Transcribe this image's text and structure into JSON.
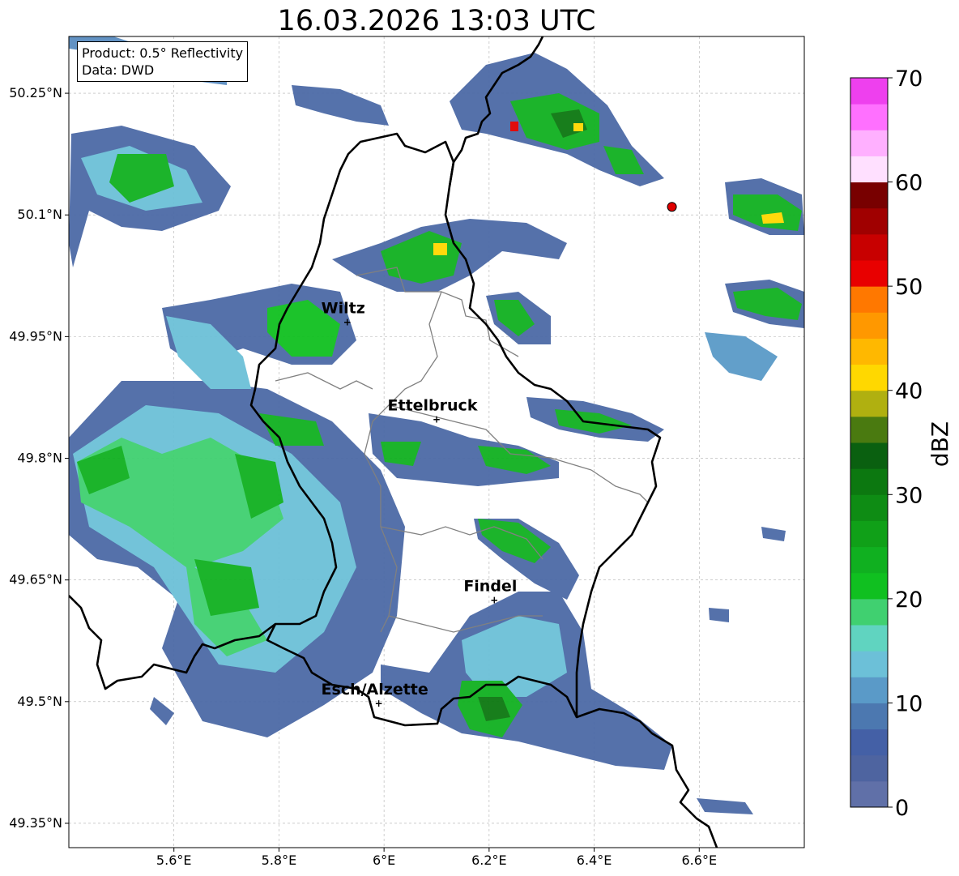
{
  "title": "16.03.2026 13:03 UTC",
  "info_box": {
    "product": "Product: 0.5° Reflectivity",
    "data": "Data: DWD"
  },
  "axes": {
    "lon_range": [
      5.4,
      6.8
    ],
    "lat_range": [
      49.32,
      50.32
    ],
    "x_ticks": [
      {
        "value": 5.6,
        "label": "5.6°E"
      },
      {
        "value": 5.8,
        "label": "5.8°E"
      },
      {
        "value": 6.0,
        "label": "6°E"
      },
      {
        "value": 6.2,
        "label": "6.2°E"
      },
      {
        "value": 6.4,
        "label": "6.4°E"
      },
      {
        "value": 6.6,
        "label": "6.6°E"
      }
    ],
    "y_ticks": [
      {
        "value": 49.35,
        "label": "49.35°N"
      },
      {
        "value": 49.5,
        "label": "49.5°N"
      },
      {
        "value": 49.65,
        "label": "49.65°N"
      },
      {
        "value": 49.8,
        "label": "49.8°N"
      },
      {
        "value": 49.95,
        "label": "49.95°N"
      },
      {
        "value": 50.1,
        "label": "50.1°N"
      },
      {
        "value": 50.25,
        "label": "50.25°N"
      }
    ],
    "grid": true
  },
  "cities": [
    {
      "name": "Wiltz",
      "lon": 5.93,
      "lat": 49.968
    },
    {
      "name": "Ettelbruck",
      "lon": 6.1,
      "lat": 49.848
    },
    {
      "name": "Findel",
      "lon": 6.21,
      "lat": 49.625
    },
    {
      "name": "Esch/Alzette",
      "lon": 5.99,
      "lat": 49.498
    }
  ],
  "radar_site": {
    "lon": 6.548,
    "lat": 50.11,
    "color": "#e00000"
  },
  "colorbar": {
    "label": "dBZ",
    "min": 0,
    "max": 70,
    "ticks": [
      "0",
      "10",
      "20",
      "30",
      "40",
      "50",
      "60",
      "70"
    ],
    "colors": [
      "#6070a8",
      "#4e64a0",
      "#4460a6",
      "#4c78b0",
      "#5a9ac8",
      "#6cc0d8",
      "#60d4c0",
      "#40d070",
      "#10c020",
      "#10b020",
      "#10a018",
      "#0e8c14",
      "#0c7810",
      "#0a6010",
      "#4a7a10",
      "#b0b010",
      "#ffd800",
      "#ffb800",
      "#ff9800",
      "#ff7800",
      "#e80000",
      "#c80000",
      "#a00000",
      "#780000",
      "#ffe0ff",
      "#ffb0ff",
      "#ff70ff",
      "#ee40ee"
    ]
  },
  "colors": {
    "border_country": "#000000",
    "border_canton": "#808080",
    "grid": "#b0b0b0"
  }
}
